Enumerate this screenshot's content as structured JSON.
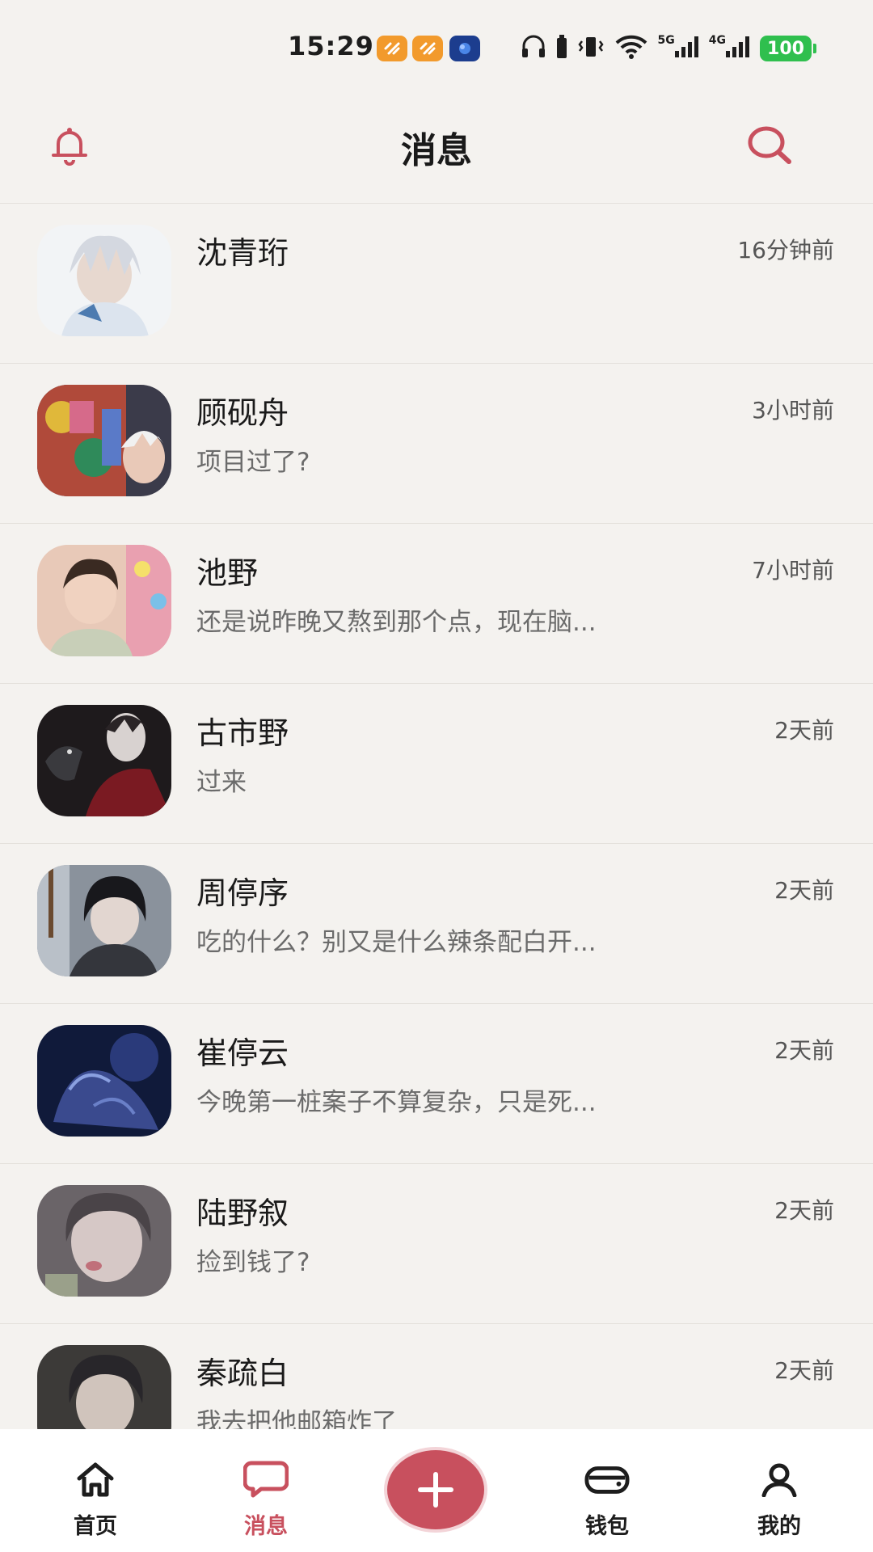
{
  "status_bar": {
    "time": "15:29",
    "battery": "100",
    "net1": "5G",
    "net2": "4G",
    "accent_battery": "#2fbf4e"
  },
  "header": {
    "title": "消息",
    "left_icon": "bell-icon",
    "right_icon": "search-icon"
  },
  "colors": {
    "accent": "#c8505e",
    "background": "#f4f2ef"
  },
  "messages": [
    {
      "name": "沈青珩",
      "time": "16分钟前",
      "preview": ""
    },
    {
      "name": "顾砚舟",
      "time": "3小时前",
      "preview": "项目过了?"
    },
    {
      "name": "池野",
      "time": "7小时前",
      "preview": "还是说昨晚又熬到那个点，现在脑..."
    },
    {
      "name": "古市野",
      "time": "2天前",
      "preview": "过来"
    },
    {
      "name": "周停序",
      "time": "2天前",
      "preview": "吃的什么？别又是什么辣条配白开..."
    },
    {
      "name": "崔停云",
      "time": "2天前",
      "preview": "今晚第一桩案子不算复杂，只是死..."
    },
    {
      "name": "陆野叙",
      "time": "2天前",
      "preview": "捡到钱了?"
    },
    {
      "name": "秦疏白",
      "time": "2天前",
      "preview": "我去把他邮箱炸了"
    }
  ],
  "nav": {
    "home": "首页",
    "messages": "消息",
    "wallet": "钱包",
    "profile": "我的",
    "create_icon": "plus-icon"
  }
}
